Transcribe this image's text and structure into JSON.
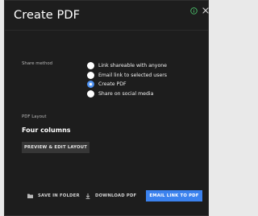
{
  "dialog": {
    "title": "Create PDF",
    "header_icons": [
      "info-icon",
      "close-icon"
    ]
  },
  "share_method": {
    "label": "Share method",
    "options": [
      {
        "label": "Link shareable with anyone",
        "selected": false
      },
      {
        "label": "Email link to selected users",
        "selected": false
      },
      {
        "label": "Create PDF",
        "selected": true
      },
      {
        "label": "Share on social media",
        "selected": false
      }
    ]
  },
  "pdf_layout": {
    "label": "PDF Layout",
    "value": "Four columns",
    "preview_button": "PREVIEW & EDIT LAYOUT"
  },
  "footer": {
    "save_label": "SAVE IN FOLDER",
    "save_icon": "folder-icon",
    "download_label": "DOWNLOAD PDF",
    "download_icon": "download-icon",
    "email_label": "EMAIL LINK TO PDF"
  },
  "colors": {
    "background": "#1d1d1d",
    "accent": "#3b82ee",
    "info_icon": "#4bbd6a"
  }
}
